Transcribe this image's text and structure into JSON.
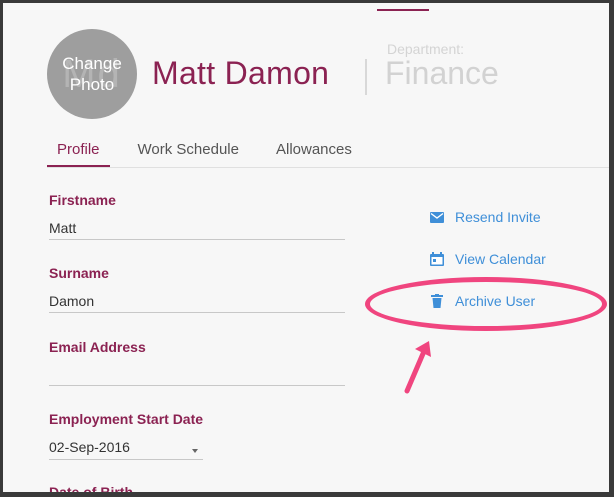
{
  "header": {
    "avatar_label": "Change Photo",
    "avatar_initials": "Md",
    "user_name": "Matt Damon",
    "department_label": "Department:",
    "department_value": "Finance"
  },
  "tabs": [
    {
      "label": "Profile",
      "active": true
    },
    {
      "label": "Work Schedule",
      "active": false
    },
    {
      "label": "Allowances",
      "active": false
    }
  ],
  "form": {
    "firstname_label": "Firstname",
    "firstname_value": "Matt",
    "surname_label": "Surname",
    "surname_value": "Damon",
    "email_label": "Email Address",
    "email_value": "",
    "start_date_label": "Employment Start Date",
    "start_date_value": "02-Sep-2016",
    "dob_label": "Date of Birth"
  },
  "actions": [
    {
      "label": "Resend Invite",
      "icon": "envelope-icon"
    },
    {
      "label": "View Calendar",
      "icon": "calendar-icon"
    },
    {
      "label": "Archive User",
      "icon": "trash-icon"
    }
  ],
  "colors": {
    "brand": "#8b2252",
    "action_link": "#3f8fd8",
    "annotation": "#f0457f"
  }
}
